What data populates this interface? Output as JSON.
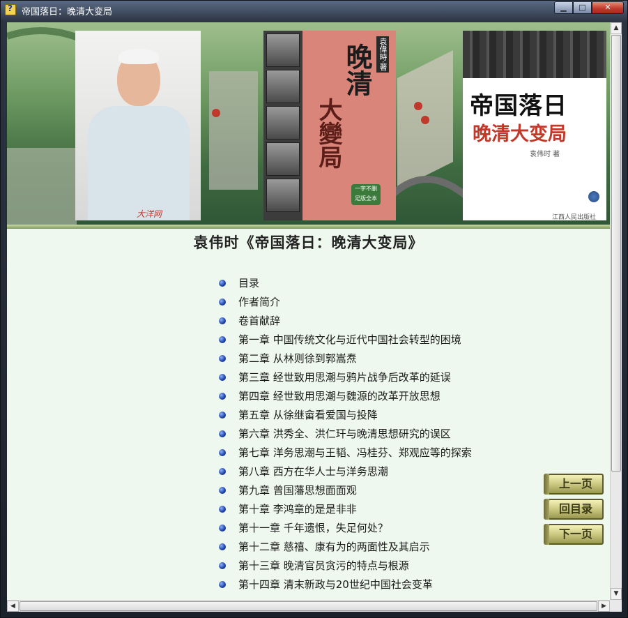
{
  "window": {
    "title": "帝国落日：晚清大变局",
    "minimize_label": "▁",
    "maximize_label": "□",
    "close_label": "✕"
  },
  "banner": {
    "photo_watermark": "大洋网",
    "book1": {
      "title_top": "晚清",
      "title_bottom": "大變局",
      "author": "袁偉時·著",
      "tag": "一字不删 足版全本"
    },
    "book2": {
      "title": "帝国落日",
      "subtitle": "晚清大变局",
      "author": "袁伟时 著",
      "publisher": "江西人民出版社"
    }
  },
  "page": {
    "title": "袁伟时《帝国落日：晚清大变局》"
  },
  "toc": [
    "目录",
    "作者简介",
    "卷首献辞",
    "第一章  中国传统文化与近代中国社会转型的困境",
    "第二章  从林则徐到郭嵩焘",
    "第三章  经世致用思潮与鸦片战争后改革的延误",
    "第四章  经世致用思潮与魏源的改革开放思想",
    "第五章  从徐继畲看爱国与投降",
    "第六章  洪秀全、洪仁玕与晚清思想研究的误区",
    "第七章  洋务思潮与王韬、冯桂芬、郑观应等的探索",
    "第八章  西方在华人士与洋务思潮",
    "第九章  曾国藩思想面面观",
    "第十章  李鸿章的是是非非",
    "第十一章  千年遗恨，失足何处？",
    "第十二章  慈禧、康有为的两面性及其启示",
    "第十三章  晚清官员贪污的特点与根源",
    "第十四章  清末新政与20世纪中国社会变革"
  ],
  "nav": {
    "prev": "上一页",
    "index": "回目录",
    "next": "下一页"
  },
  "scroll": {
    "up": "▲",
    "down": "▼",
    "left": "◀",
    "right": "▶"
  }
}
